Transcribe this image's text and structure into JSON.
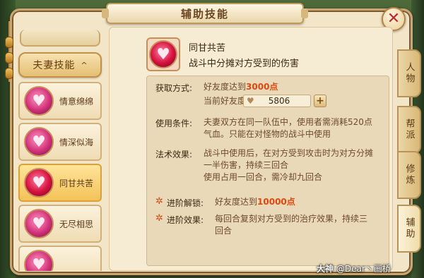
{
  "window": {
    "title": "辅助技能",
    "close_glyph": "✕"
  },
  "list": {
    "category": {
      "label": "夫妻技能",
      "caret": "^"
    },
    "items": [
      {
        "label": "情意绵绵",
        "icon": "heart-icon",
        "active": false
      },
      {
        "label": "情深似海",
        "icon": "heart-icon",
        "active": false
      },
      {
        "label": "同甘共苦",
        "icon": "heart-icon",
        "active": true
      },
      {
        "label": "无尽相思",
        "icon": "heart-icon",
        "active": false
      }
    ]
  },
  "tabs": [
    {
      "label": "人物",
      "active": false
    },
    {
      "label": "帮派",
      "active": false
    },
    {
      "label": "修炼",
      "active": false
    },
    {
      "label": "辅助",
      "active": true
    }
  ],
  "detail": {
    "title": "同甘共苦",
    "description": "战斗中分摊对方受到的伤害",
    "acquire_label": "获取方式:",
    "acquire_text": "好友度达到",
    "acquire_value": "3000点",
    "current_label": "当前好友度",
    "current_value": "5806",
    "plus_glyph": "+",
    "use_label": "使用条件:",
    "use_line1": "夫妻双方在同一队伍中，使用者需消耗520点",
    "use_line2": "气血。只能在对怪物的战斗中使用",
    "effect_label": "法术效果:",
    "effect_line1": "战斗中使用后，在对方受到攻击时为对方分摊",
    "effect_line2": "一半伤害，持续三回合",
    "effect_line3": "使用占用一回合，需冷却九回合",
    "adv_unlock_label": "进阶解锁:",
    "adv_unlock_text": "好友度达到",
    "adv_unlock_value": "10000点",
    "adv_effect_label": "进阶效果:",
    "adv_effect_line1": "每回合复刻对方受到的治疗效果，持续三",
    "adv_effect_line2": "回合",
    "star_glyph": "✲"
  },
  "watermark": {
    "brand": "大神",
    "text": "@Dear丶画桥"
  },
  "colors": {
    "highlight": "#e0470c",
    "frame": "#c9a672",
    "tab": "#d8b877"
  }
}
